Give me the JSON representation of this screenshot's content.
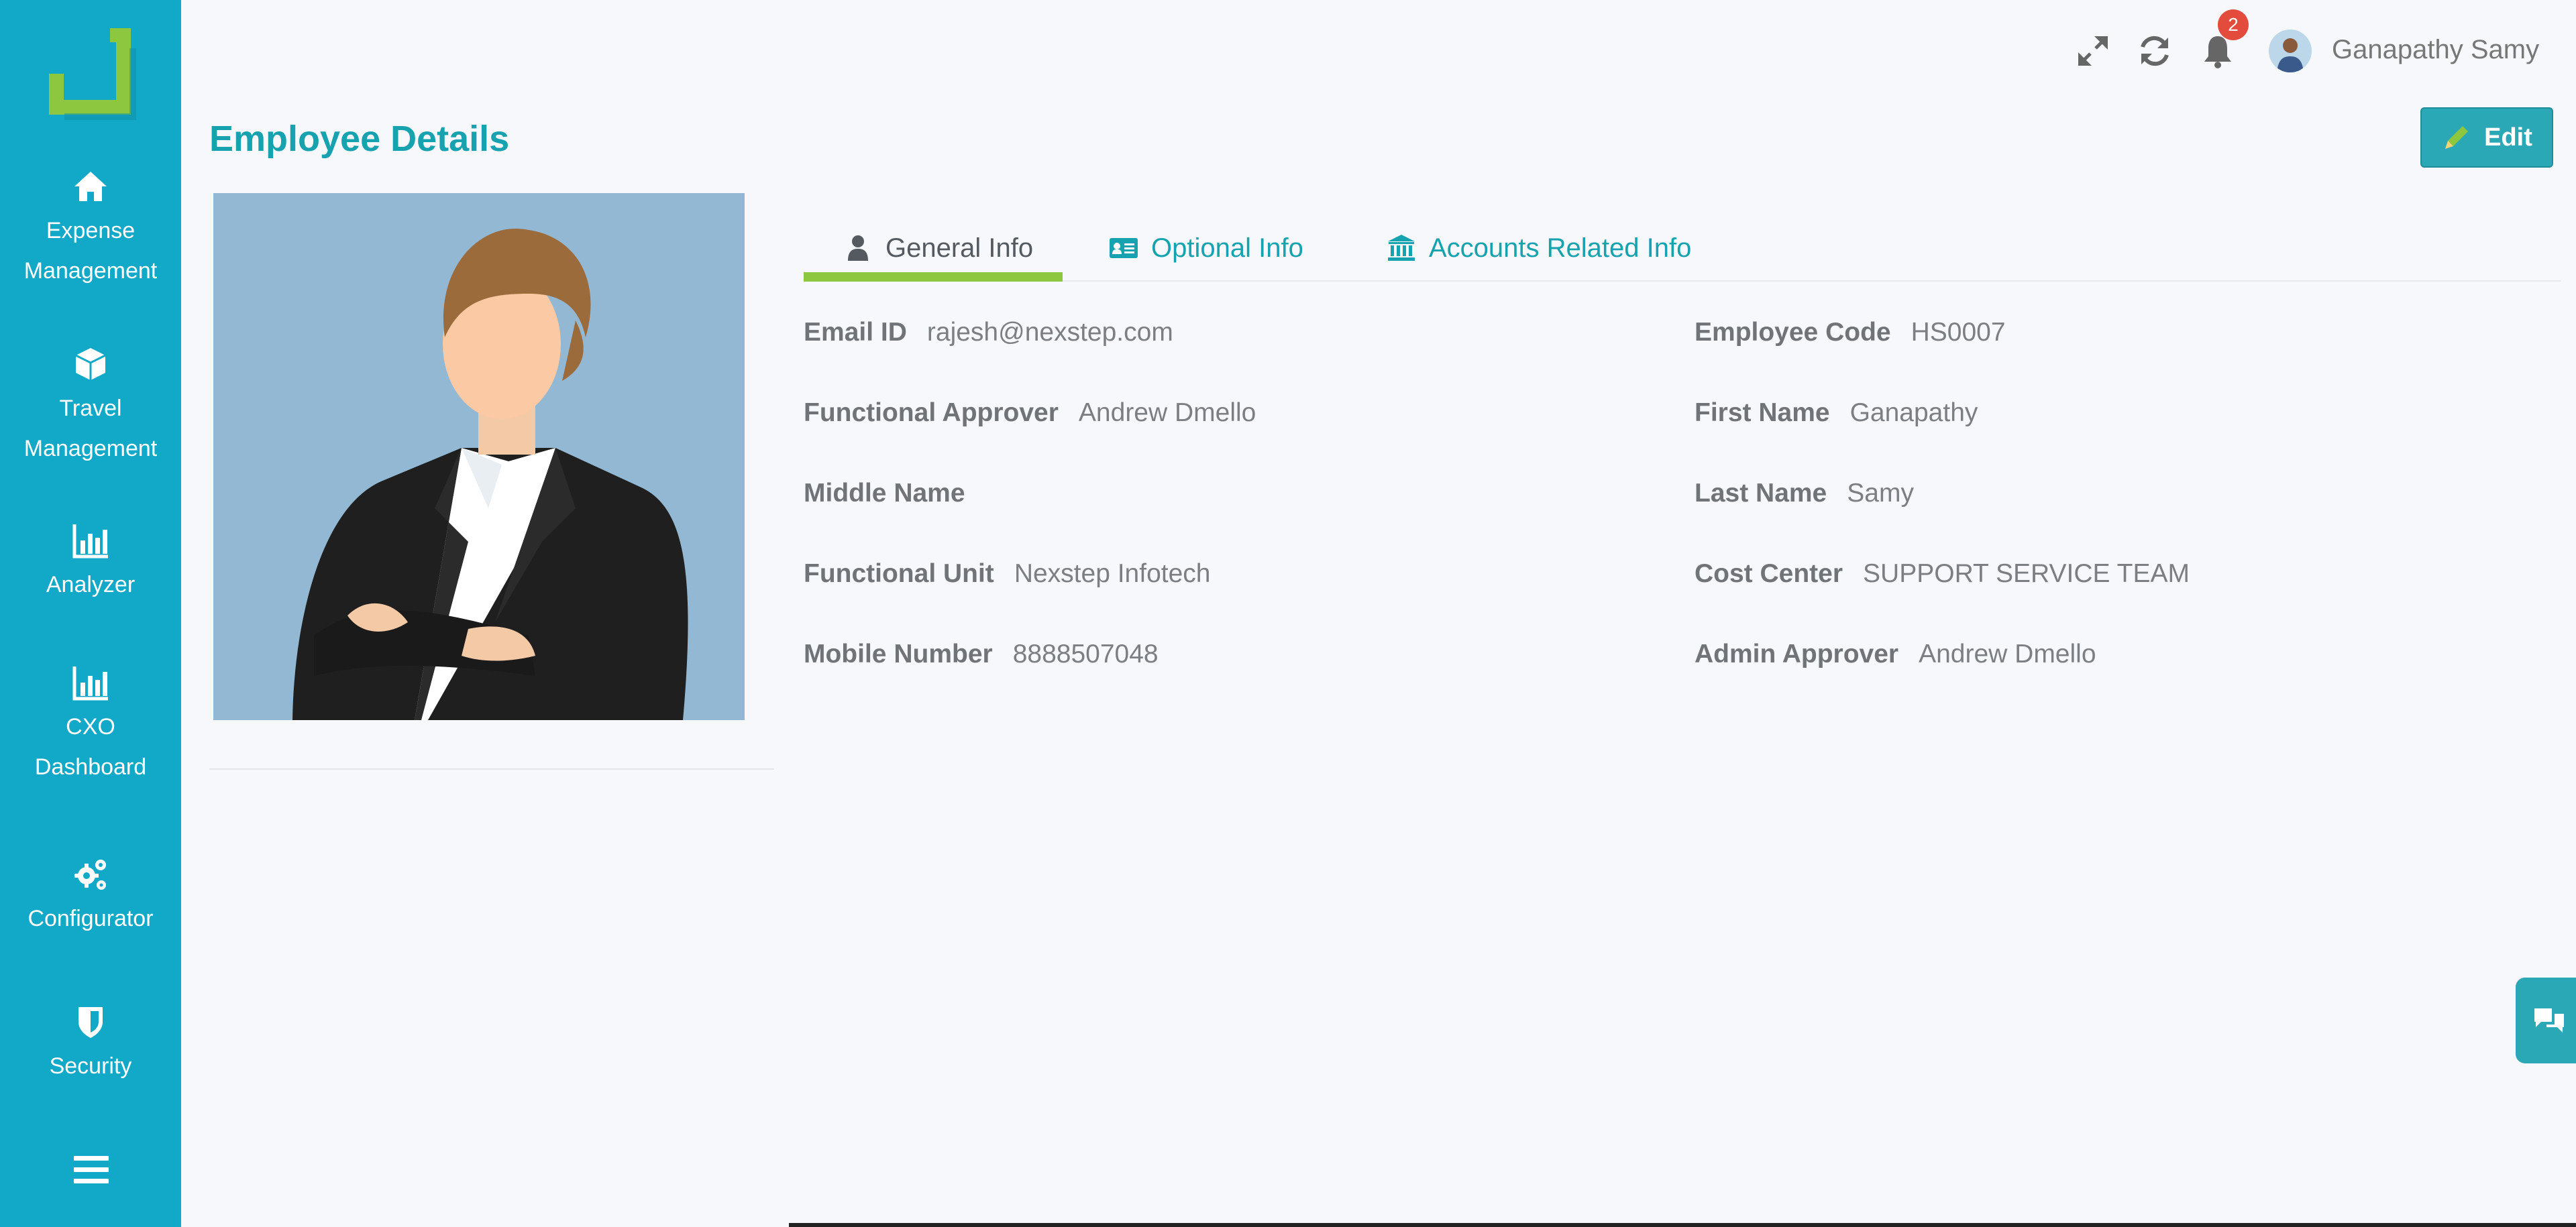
{
  "colors": {
    "sidebar": "#12a8c7",
    "accent": "#17a2b0",
    "tab_indicator": "#8dc63f",
    "badge": "#e34b3c"
  },
  "sidebar": {
    "logo_icon": "brand-logo-icon",
    "items": [
      {
        "label_line1": "Expense",
        "label_line2": "Management",
        "icon": "home-icon"
      },
      {
        "label_line1": "Travel",
        "label_line2": "Management",
        "icon": "cube-icon"
      },
      {
        "label_line1": "Analyzer",
        "icon": "bar-chart-icon"
      },
      {
        "label_line1": "CXO",
        "label_line2": "Dashboard",
        "icon": "bar-chart-icon"
      },
      {
        "label_line1": "Configurator",
        "icon": "gears-icon"
      },
      {
        "label_line1": "Security",
        "icon": "shield-icon"
      }
    ],
    "menu_icon": "hamburger-icon"
  },
  "topbar": {
    "notification_count": "2",
    "user_name": "Ganapathy Samy",
    "icons": [
      "expand-icon",
      "refresh-icon",
      "bell-icon"
    ]
  },
  "page": {
    "title": "Employee Details",
    "edit_label": "Edit"
  },
  "tabs": [
    {
      "label": "General Info",
      "icon": "user-icon",
      "active": true
    },
    {
      "label": "Optional Info",
      "icon": "id-card-icon",
      "active": false
    },
    {
      "label": "Accounts Related Info",
      "icon": "bank-icon",
      "active": false
    }
  ],
  "general_info": {
    "left": [
      {
        "label": "Email ID",
        "value": "rajesh@nexstep.com"
      },
      {
        "label": "Functional Approver",
        "value": "Andrew Dmello"
      },
      {
        "label": "Middle Name",
        "value": ""
      },
      {
        "label": "Functional Unit",
        "value": "Nexstep Infotech"
      },
      {
        "label": "Mobile Number",
        "value": "8888507048"
      }
    ],
    "right": [
      {
        "label": "Employee Code",
        "value": "HS0007"
      },
      {
        "label": "First Name",
        "value": "Ganapathy"
      },
      {
        "label": "Last Name",
        "value": "Samy"
      },
      {
        "label": "Cost Center",
        "value": "SUPPORT SERVICE TEAM"
      },
      {
        "label": "Admin Approver",
        "value": "Andrew Dmello"
      }
    ]
  }
}
